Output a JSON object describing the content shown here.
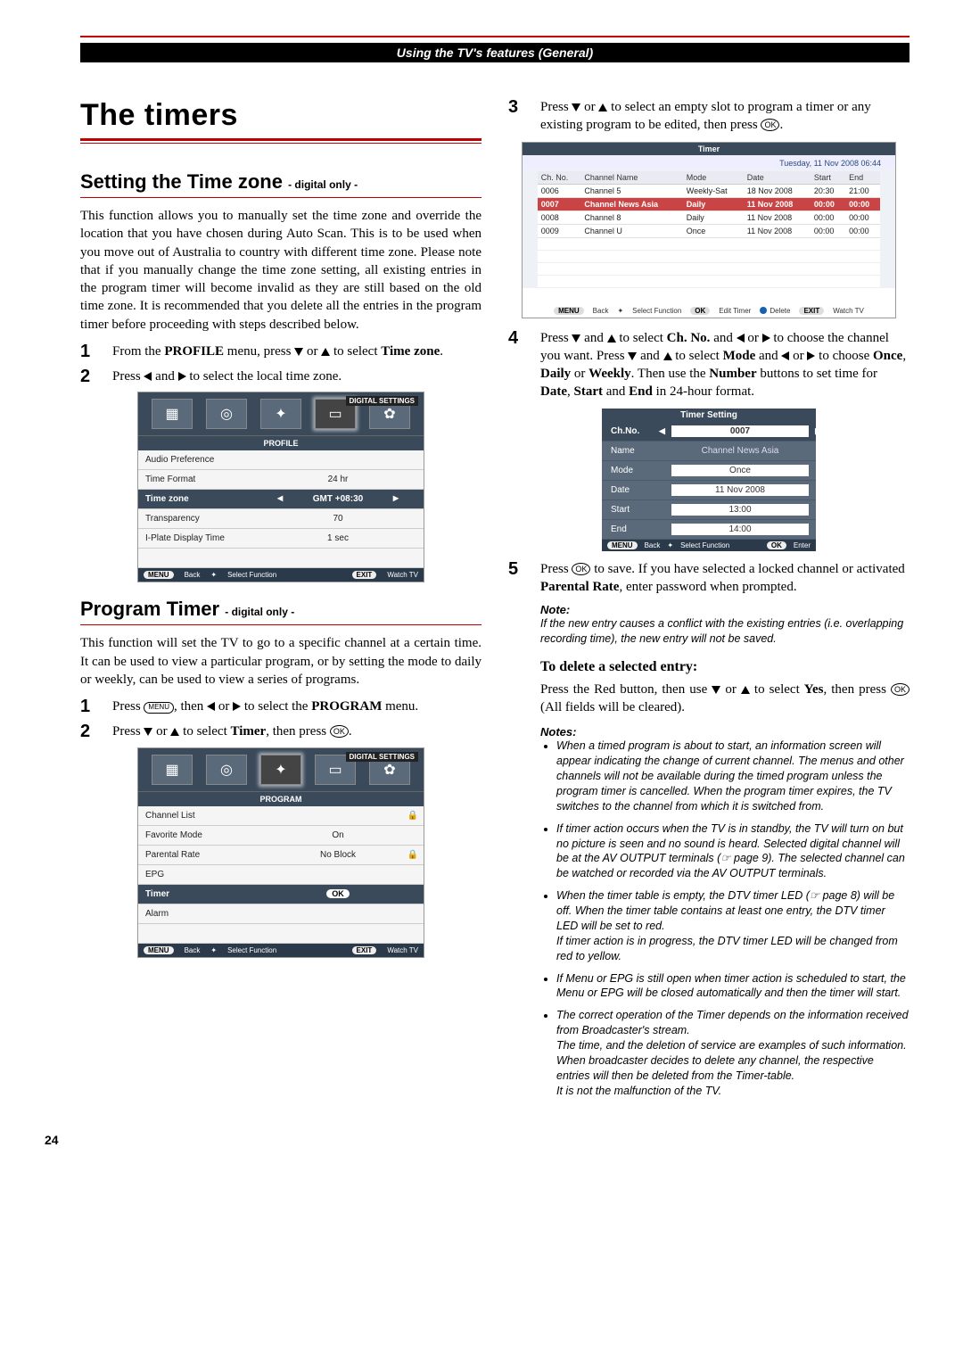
{
  "banner": "Using the TV's features (General)",
  "title": "The timers",
  "sec1": {
    "heading": "Setting the Time zone",
    "suffix": "- digital only -",
    "intro": "This function allows you to manually set the time zone and override the location that you have chosen during Auto Scan. This is to be used when you move out of Australia to country with different time zone. Please note that if you manually change the time zone setting, all existing entries in the program timer will become invalid as they are still based on the old time zone. It is recommended that you delete all the entries in the program timer before proceeding with steps described below.",
    "step1a": "From the ",
    "step1b": "PROFILE",
    "step1c": " menu, press ",
    "step1d": " or ",
    "step1e": " to select ",
    "step1f": "Time zone",
    "step1g": ".",
    "step2a": "Press ",
    "step2b": " and ",
    "step2c": " to select the local time zone."
  },
  "osd1": {
    "tag": "DIGITAL SETTINGS",
    "band": "PROFILE",
    "rows": [
      {
        "lab": "Audio Preference",
        "val": ""
      },
      {
        "lab": "Time Format",
        "val": "24 hr"
      },
      {
        "lab": "Time zone",
        "val": "GMT +08:30",
        "sel": true
      },
      {
        "lab": "Transparency",
        "val": "70"
      },
      {
        "lab": "I-Plate Display Time",
        "val": "1 sec"
      }
    ],
    "footer": {
      "menu": "MENU",
      "back": "Back",
      "sel": "Select Function",
      "exit": "EXIT",
      "watch": "Watch TV"
    }
  },
  "sec2": {
    "heading": "Program Timer",
    "suffix": "- digital only -",
    "intro": "This function will set the TV to go to a specific channel at a certain time. It can be used to view a particular program, or by setting the mode to daily or weekly, can be used to view a series of programs.",
    "step1a": "Press ",
    "step1b": ", then ",
    "step1c": " or ",
    "step1d": " to select the ",
    "step1e": "PROGRAM",
    "step1f": " menu.",
    "step2a": "Press ",
    "step2b": " or ",
    "step2c": " to select ",
    "step2d": "Timer",
    "step2e": ", then press ",
    "step2f": "."
  },
  "osd2": {
    "tag": "DIGITAL SETTINGS",
    "band": "PROGRAM",
    "rows": [
      {
        "lab": "Channel List",
        "val": "",
        "lock": true
      },
      {
        "lab": "Favorite Mode",
        "val": "On"
      },
      {
        "lab": "Parental Rate",
        "val": "No Block",
        "lock": true
      },
      {
        "lab": "EPG",
        "val": ""
      },
      {
        "lab": "Timer",
        "val": "OK",
        "sel": true,
        "ok": true
      },
      {
        "lab": "Alarm",
        "val": ""
      }
    ],
    "footer": {
      "menu": "MENU",
      "back": "Back",
      "sel": "Select Function",
      "exit": "EXIT",
      "watch": "Watch TV"
    }
  },
  "right": {
    "step3a": "Press ",
    "step3b": " or ",
    "step3c": " to select an empty slot to program a timer or any existing program to be edited, then press ",
    "step3d": ".",
    "step4a": "Press ",
    "step4b": " and ",
    "step4c": " to select ",
    "step4d": "Ch. No.",
    "step4e": " and ",
    "step4f": " or ",
    "step4g": " to choose the channel you want. Press ",
    "step4h": " and ",
    "step4i": " to select ",
    "step4j": "Mode",
    "step4k": " and ",
    "step4l": " or ",
    "step4m": " to choose ",
    "step4n": "Once",
    "step4o": ", ",
    "step4p": "Daily",
    "step4q": " or ",
    "step4r": "Weekly",
    "step4s": ". Then use the ",
    "step4t": "Number",
    "step4u": " buttons to set time for ",
    "step4v": "Date",
    "step4w": ", ",
    "step4x": "Start",
    "step4y": " and ",
    "step4z": "End",
    "step4z2": " in 24-hour format.",
    "step5a": "Press ",
    "step5b": " to save. If you have selected a locked channel or activated ",
    "step5c": "Parental Rate",
    "step5d": ", enter password when prompted.",
    "noteHead": "Note:",
    "noteBody": "If the new entry causes a conflict with the existing entries (i.e. overlapping recording time), the new entry will not be saved.",
    "delHead": "To delete a selected entry:",
    "delBodyA": "Press the Red button, then use ",
    "delBodyB": " or ",
    "delBodyC": " to select ",
    "delBodyD": "Yes",
    "delBodyE": ", then press ",
    "delBodyF": " (All fields will be cleared).",
    "notesHead": "Notes:",
    "notes": [
      "When a timed program is about to start, an information screen will appear indicating the change of current channel. The menus and other channels will not be available during the timed program unless the program timer is cancelled. When the program timer expires, the TV switches to the channel from which it is switched from.",
      "If timer action occurs when the TV is in standby, the TV will turn on but no picture is seen and no sound is heard. Selected digital channel will be at the AV OUTPUT terminals (☞ page 9). The selected channel can be watched or recorded via the AV OUTPUT terminals.",
      "When the timer table is empty, the DTV timer LED (☞ page 8) will be off. When the timer table contains at least one entry, the DTV timer LED will be set to red.\nIf timer action is in progress, the DTV timer LED will be changed from red to yellow.",
      "If Menu or EPG is still open when timer action is scheduled to start, the Menu or EPG will be closed automatically and then the timer will start.",
      "The correct operation of the Timer depends on the information received from Broadcaster's stream.\nThe time, and the deletion of service are examples of such information. When broadcaster decides to delete any channel, the respective entries will then be deleted from the Timer-table.\nIt is not the malfunction of the TV."
    ]
  },
  "timerPanel": {
    "title": "Timer",
    "date": "Tuesday, 11 Nov 2008   06:44",
    "headers": [
      "Ch. No.",
      "Channel Name",
      "Mode",
      "Date",
      "Start",
      "End"
    ],
    "rows": [
      {
        "ch": "0006",
        "name": "Channel 5",
        "mode": "Weekly-Sat",
        "date": "18 Nov 2008",
        "start": "20:30",
        "end": "21:00"
      },
      {
        "ch": "0007",
        "name": "Channel News Asia",
        "mode": "Daily",
        "date": "11 Nov 2008",
        "start": "00:00",
        "end": "00:00",
        "sel": true
      },
      {
        "ch": "0008",
        "name": "Channel 8",
        "mode": "Daily",
        "date": "11 Nov 2008",
        "start": "00:00",
        "end": "00:00"
      },
      {
        "ch": "0009",
        "name": "Channel U",
        "mode": "Once",
        "date": "11 Nov 2008",
        "start": "00:00",
        "end": "00:00"
      }
    ],
    "footer": {
      "menu": "MENU",
      "back": "Back",
      "sel": "Select Function",
      "ok": "OK",
      "edit": "Edit Timer",
      "del": "Delete",
      "exit": "EXIT",
      "watch": "Watch TV"
    }
  },
  "tsPanel": {
    "title": "Timer Setting",
    "rows": [
      {
        "l": "Ch.No.",
        "v": "0007",
        "sel": true
      },
      {
        "l": "Name",
        "v": "Channel News Asia",
        "noBox": true
      },
      {
        "l": "Mode",
        "v": "Once"
      },
      {
        "l": "Date",
        "v": "11 Nov 2008"
      },
      {
        "l": "Start",
        "v": "13:00"
      },
      {
        "l": "End",
        "v": "14:00"
      }
    ],
    "footer": {
      "menu": "MENU",
      "back": "Back",
      "sel": "Select Function",
      "ok": "OK",
      "enter": "Enter"
    }
  },
  "pageNum": "24"
}
